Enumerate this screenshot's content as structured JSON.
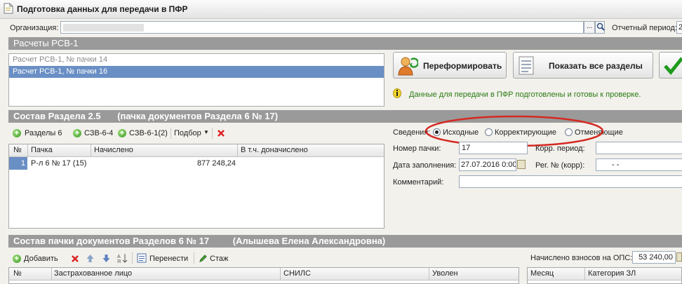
{
  "window": {
    "title": "Подготовка данных для передачи в ПФР"
  },
  "org": {
    "label": "Организация:",
    "value": "",
    "dots": "...",
    "period_label": "Отчетный период:",
    "period_value": "2"
  },
  "rsv": {
    "section_title": "Расчеты РСВ-1",
    "items": [
      {
        "label": "Расчет РСВ-1, № пачки 14"
      },
      {
        "label": "Расчет РСВ-1, № пачки 16"
      }
    ],
    "reform_button": "Переформировать",
    "show_sections_button": "Показать все разделы",
    "info_text": "Данные для передачи в ПФР подготовлены и готовы к проверке."
  },
  "section25": {
    "title": "Состав Раздела 2.5",
    "subtitle": "(пачка документов Раздела 6 № 17)",
    "toolbar": {
      "sections6": "Разделы 6",
      "szv64": "СЗВ-6-4",
      "szv61": "СЗВ-6-1(2)",
      "podbor": "Подбор"
    },
    "columns": [
      "№",
      "Пачка",
      "Начислено",
      "В т.ч. доначислено"
    ],
    "rows": [
      {
        "num": "1",
        "pack": "Р-л 6 № 17 (15)",
        "accrued": "877 248,24",
        "extra": ""
      }
    ]
  },
  "form": {
    "svedenia_label": "Сведения:",
    "radio": [
      "Исходные",
      "Корректирующие",
      "Отменяющие"
    ],
    "pack_num_label": "Номер пачки:",
    "pack_num_value": "17",
    "corr_period_label": "Корр. период:",
    "corr_period_value": "",
    "date_label": "Дата заполнения:",
    "date_value": "27.07.2016  0:00",
    "reg_label": "Рег. № (корр):",
    "reg_value": "-    -",
    "comment_label": "Комментарий:",
    "comment_value": ""
  },
  "section6": {
    "title": "Состав пачки документов Разделов 6 № 17",
    "person": "(Алышева Елена Александровна)",
    "toolbar": {
      "add": "Добавить",
      "move": "Перенести",
      "stazh": "Стаж"
    },
    "columns": [
      "№",
      "Застрахованное лицо",
      "СНИЛС",
      "Уволен"
    ],
    "ops_label": "Начислено взносов на ОПС:",
    "ops_value": "53 240,00",
    "right_columns": [
      "Месяц",
      "Категория ЗЛ"
    ]
  },
  "colors": {
    "section_bg": "#9a9a9a",
    "selection": "#6a8fc5",
    "highlight_ellipse": "#d42a22",
    "info_green": "#2a7a12"
  }
}
